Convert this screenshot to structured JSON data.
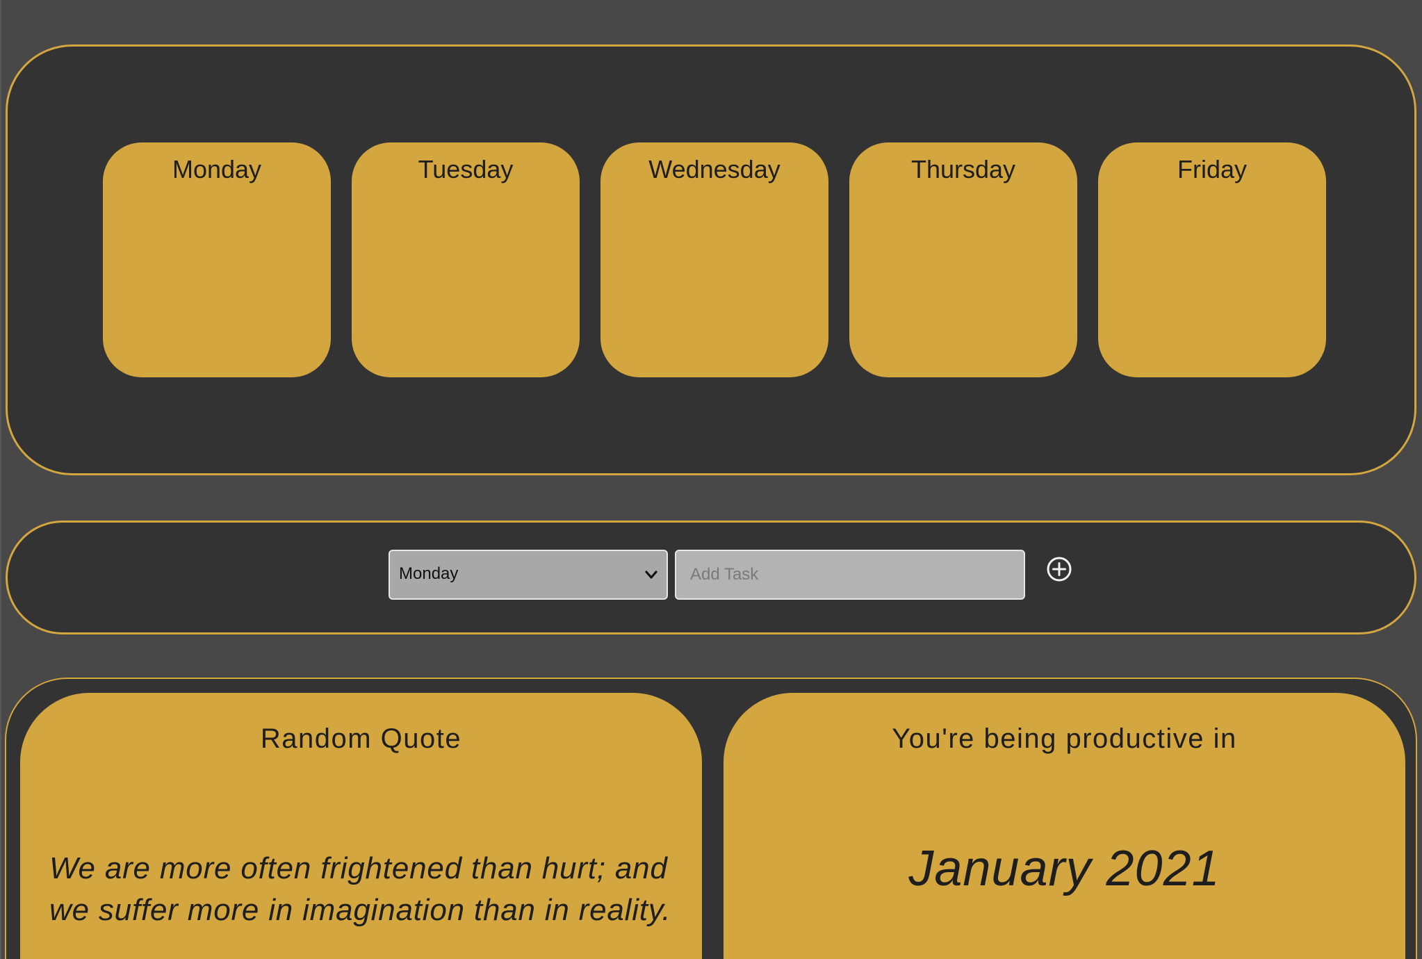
{
  "colors": {
    "page_background": "#484848",
    "panel_background": "#333333",
    "accent": "#d4a63f",
    "text_dark": "#1e1e1e"
  },
  "week": {
    "days": [
      {
        "label": "Monday"
      },
      {
        "label": "Tuesday"
      },
      {
        "label": "Wednesday"
      },
      {
        "label": "Thursday"
      },
      {
        "label": "Friday"
      }
    ]
  },
  "add_task": {
    "selected_day": "Monday",
    "options": [
      "Monday",
      "Tuesday",
      "Wednesday",
      "Thursday",
      "Friday"
    ],
    "input_value": "",
    "input_placeholder": "Add Task",
    "add_icon": "plus-circle-icon",
    "select_icon": "chevron-down-icon"
  },
  "quote_card": {
    "heading": "Random Quote",
    "quote": "We are more often frightened than hurt; and we suffer more in imagination than in reality."
  },
  "date_card": {
    "heading": "You're being productive in",
    "month": "January 2021"
  }
}
